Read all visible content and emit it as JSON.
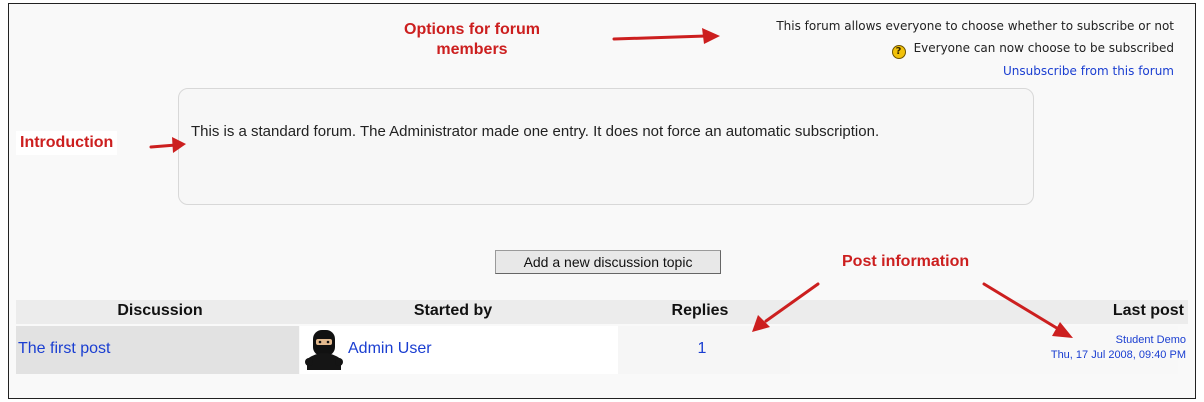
{
  "annotations": {
    "options": "Options for forum members",
    "introduction": "Introduction",
    "post_information": "Post information"
  },
  "subscription": {
    "allows_text": "This forum allows everyone to choose whether to subscribe or not",
    "everyone_text": "Everyone can now choose to be subscribed",
    "unsubscribe_link": "Unsubscribe from this forum"
  },
  "intro": {
    "text": "This is a standard forum. The Administrator made one entry. It does not force an automatic subscription."
  },
  "actions": {
    "add_topic": "Add a new discussion topic"
  },
  "table": {
    "headers": {
      "discussion": "Discussion",
      "started_by": "Started by",
      "replies": "Replies",
      "last_post": "Last post"
    },
    "rows": [
      {
        "discussion": "The first post",
        "started_by": "Admin User",
        "replies": "1",
        "last_post_author": "Student Demo",
        "last_post_date": "Thu, 17 Jul 2008, 09:40 PM"
      }
    ]
  },
  "colors": {
    "annotation_red": "#cc1f1f",
    "link_blue": "#1a3ed1"
  },
  "icons": {
    "help": "question-mark-icon",
    "avatar": "ninja-avatar-icon"
  }
}
